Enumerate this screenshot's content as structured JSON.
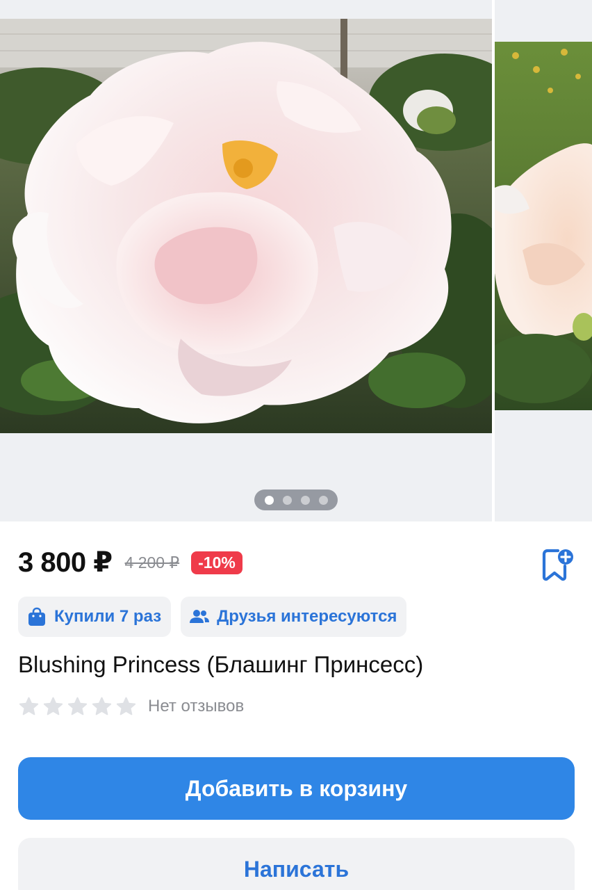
{
  "gallery": {
    "slide_count": 4,
    "active_slide": 1,
    "image_1_subject": "white-pink peony flower",
    "image_2_subject": "pale peach peony flower"
  },
  "product": {
    "price": "3 800 ₽",
    "old_price": "4 200 ₽",
    "discount": "-10%",
    "title": "Blushing Princess (Блашинг Принсесс)",
    "rating_stars": 0,
    "rating_max": 5,
    "reviews_label": "Нет отзывов"
  },
  "chips": [
    {
      "label": "Купили 7 раз",
      "icon": "shopping-bag-icon"
    },
    {
      "label": "Друзья интересуются",
      "icon": "friends-icon"
    }
  ],
  "actions": {
    "add_to_cart": "Добавить в корзину",
    "write": "Написать"
  },
  "colors": {
    "accent": "#2f86e6",
    "accent_text": "#2b74d8",
    "discount_badge": "#ef3b4a",
    "chip_bg": "#f1f2f4",
    "gallery_bg": "#eef0f3",
    "star_empty": "#dfe1e5"
  }
}
